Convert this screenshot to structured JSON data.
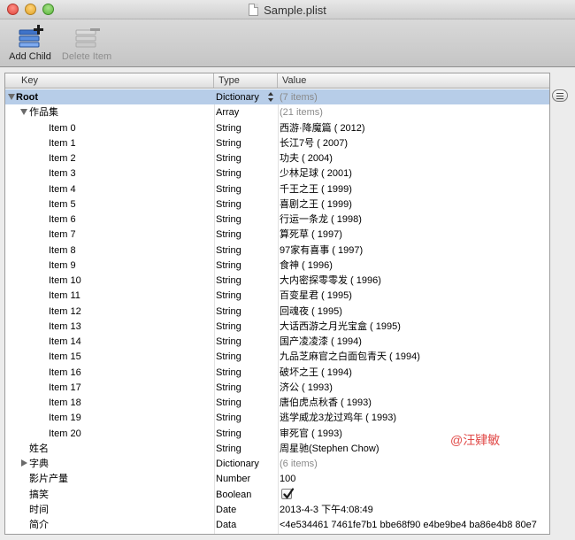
{
  "window": {
    "title": "Sample.plist"
  },
  "toolbar": {
    "add_child_label": "Add Child",
    "delete_item_label": "Delete Item"
  },
  "columns": {
    "key": "Key",
    "type": "Type",
    "value": "Value"
  },
  "rows": [
    {
      "key": "Root",
      "type": "Dictionary",
      "value": "(7 items)",
      "level": 0,
      "disclosure": "open",
      "selected": true,
      "bold_key": true,
      "muted_value": true,
      "type_stepper": true
    },
    {
      "key": "作品集",
      "type": "Array",
      "value": "(21 items)",
      "level": 1,
      "disclosure": "open",
      "muted_value": true
    },
    {
      "key": "Item 0",
      "type": "String",
      "value": "西游·降魔篇 ( 2012)",
      "level": 2
    },
    {
      "key": "Item 1",
      "type": "String",
      "value": "长江7号 ( 2007)",
      "level": 2
    },
    {
      "key": "Item 2",
      "type": "String",
      "value": "功夫 ( 2004)",
      "level": 2
    },
    {
      "key": "Item 3",
      "type": "String",
      "value": "少林足球 ( 2001)",
      "level": 2
    },
    {
      "key": "Item 4",
      "type": "String",
      "value": "千王之王 ( 1999)",
      "level": 2
    },
    {
      "key": "Item 5",
      "type": "String",
      "value": "喜剧之王 ( 1999)",
      "level": 2
    },
    {
      "key": "Item 6",
      "type": "String",
      "value": "行运一条龙 ( 1998)",
      "level": 2
    },
    {
      "key": "Item 7",
      "type": "String",
      "value": "算死草 ( 1997)",
      "level": 2
    },
    {
      "key": "Item 8",
      "type": "String",
      "value": "97家有喜事 ( 1997)",
      "level": 2
    },
    {
      "key": "Item 9",
      "type": "String",
      "value": "食神 ( 1996)",
      "level": 2
    },
    {
      "key": "Item 10",
      "type": "String",
      "value": "大内密探零零发 ( 1996)",
      "level": 2
    },
    {
      "key": "Item 11",
      "type": "String",
      "value": "百变星君 ( 1995)",
      "level": 2
    },
    {
      "key": "Item 12",
      "type": "String",
      "value": "回魂夜 ( 1995)",
      "level": 2
    },
    {
      "key": "Item 13",
      "type": "String",
      "value": "大话西游之月光宝盒 ( 1995)",
      "level": 2
    },
    {
      "key": "Item 14",
      "type": "String",
      "value": "国产凌凌漆 ( 1994)",
      "level": 2
    },
    {
      "key": "Item 15",
      "type": "String",
      "value": "九品芝麻官之白面包青天 ( 1994)",
      "level": 2
    },
    {
      "key": "Item 16",
      "type": "String",
      "value": "破坏之王 ( 1994)",
      "level": 2
    },
    {
      "key": "Item 17",
      "type": "String",
      "value": "济公 ( 1993)",
      "level": 2
    },
    {
      "key": "Item 18",
      "type": "String",
      "value": "唐伯虎点秋香 ( 1993)",
      "level": 2
    },
    {
      "key": "Item 19",
      "type": "String",
      "value": "逃学威龙3龙过鸡年 ( 1993)",
      "level": 2
    },
    {
      "key": "Item 20",
      "type": "String",
      "value": "审死官 ( 1993)",
      "level": 2
    },
    {
      "key": "姓名",
      "type": "String",
      "value": "周星驰(Stephen Chow)",
      "level": 1
    },
    {
      "key": "字典",
      "type": "Dictionary",
      "value": "(6 items)",
      "level": 1,
      "disclosure": "closed",
      "muted_value": true
    },
    {
      "key": "影片产量",
      "type": "Number",
      "value": "100",
      "level": 1
    },
    {
      "key": "搞笑",
      "type": "Boolean",
      "value": "",
      "level": 1,
      "checkbox": true,
      "checked": true
    },
    {
      "key": "时间",
      "type": "Date",
      "value": "2013-4-3 下午4:08:49",
      "level": 1
    },
    {
      "key": "简介",
      "type": "Data",
      "value": "<4e534461 7461fe7b1 bbe68f90 e4be9be4 ba86e4b8 80e7",
      "level": 1
    }
  ],
  "watermark": "@汪肄敏",
  "icons": {
    "add_child": "add-child-icon",
    "delete_item": "delete-item-icon",
    "row_menu": "row-menu-icon",
    "checkmark": "checkmark-icon"
  },
  "colors": {
    "selection": "#b7cde8",
    "watermark": "#e14a48"
  }
}
